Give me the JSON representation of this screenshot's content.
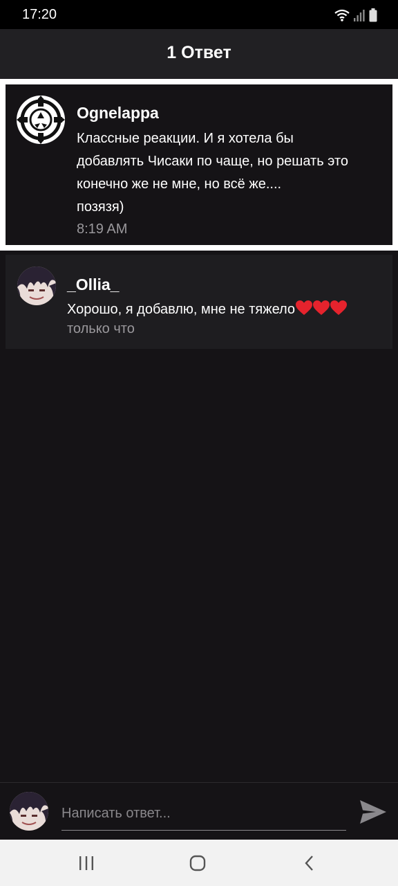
{
  "status_bar": {
    "time": "17:20",
    "icons": [
      "wifi-icon",
      "signal-icon",
      "battery-icon"
    ]
  },
  "header": {
    "title": "1 Ответ"
  },
  "parent_comment": {
    "author": "Ognelappa",
    "avatar": "scp-logo-icon",
    "text": "Классные реакции. И я хотела бы\nдобавлять Чисаки по чаще, но решать это\nконечно же не мне, но всё же....\nпозязя)",
    "time": "8:19 AM"
  },
  "reply": {
    "author": "_Ollia_",
    "text": "Хорошо, я добавлю, мне не тяжело",
    "emoji": [
      "heart",
      "heart",
      "heart"
    ],
    "time": "только что"
  },
  "reply_bar": {
    "placeholder": "Написать ответ...",
    "send_icon": "send-icon"
  },
  "nav_bar": {
    "buttons": [
      "recents-icon",
      "home-icon",
      "back-icon"
    ]
  },
  "colors": {
    "background": "#151316",
    "header": "#212023",
    "reply_bg": "#1e1d20",
    "muted_text": "#9a989c",
    "heart": "#e5232d",
    "highlight_border": "#ffffff"
  }
}
